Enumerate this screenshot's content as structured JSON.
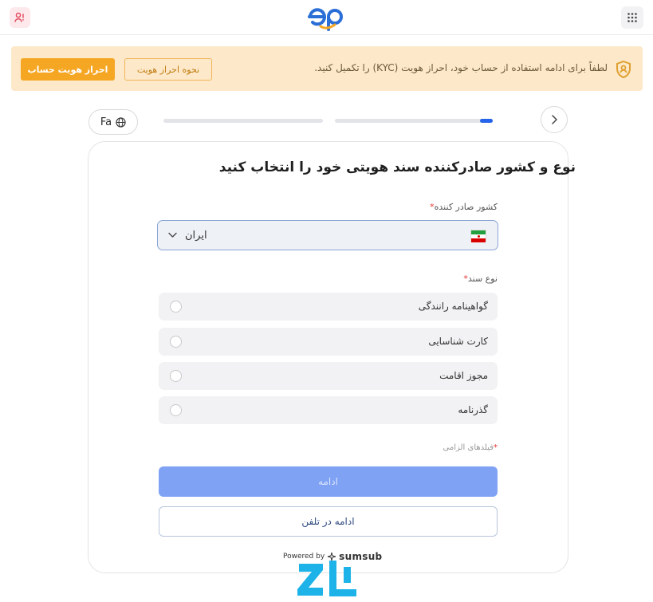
{
  "header": {
    "logo_text": "ep",
    "colors": {
      "logo_primary": "#2b6fd6",
      "logo_accent": "#f5a623"
    }
  },
  "banner": {
    "message": "لطفاً برای ادامه استفاده از حساب خود، احراز هویت (KYC) را تکمیل کنید.",
    "how_button": "نحوه احراز هویت",
    "kyc_button": "احراز هویت حساب",
    "colors": {
      "background": "#fde9c9",
      "accent": "#f5a623"
    }
  },
  "controls": {
    "language": "Fa",
    "progress": {
      "step1_fraction": 0.0,
      "step2_fraction": 0.08
    }
  },
  "form": {
    "title": "نوع و کشور صادرکننده سند هویتی خود را انتخاب کنید",
    "country_label": "کشور صادر کننده",
    "country_value": "ایران",
    "doc_type_label": "نوع سند",
    "required_mark": "*",
    "options": [
      {
        "label": "گواهینامه رانندگی"
      },
      {
        "label": "کارت شناسایی"
      },
      {
        "label": "مجوز اقامت"
      },
      {
        "label": "گذرنامه"
      }
    ],
    "required_fields_note": "فیلدهای الزامی",
    "continue_button": "ادامه",
    "phone_button": "ادامه در تلفن",
    "powered_by": "Powered by",
    "powered_brand": "sumsub"
  },
  "watermark_text": "ZL"
}
